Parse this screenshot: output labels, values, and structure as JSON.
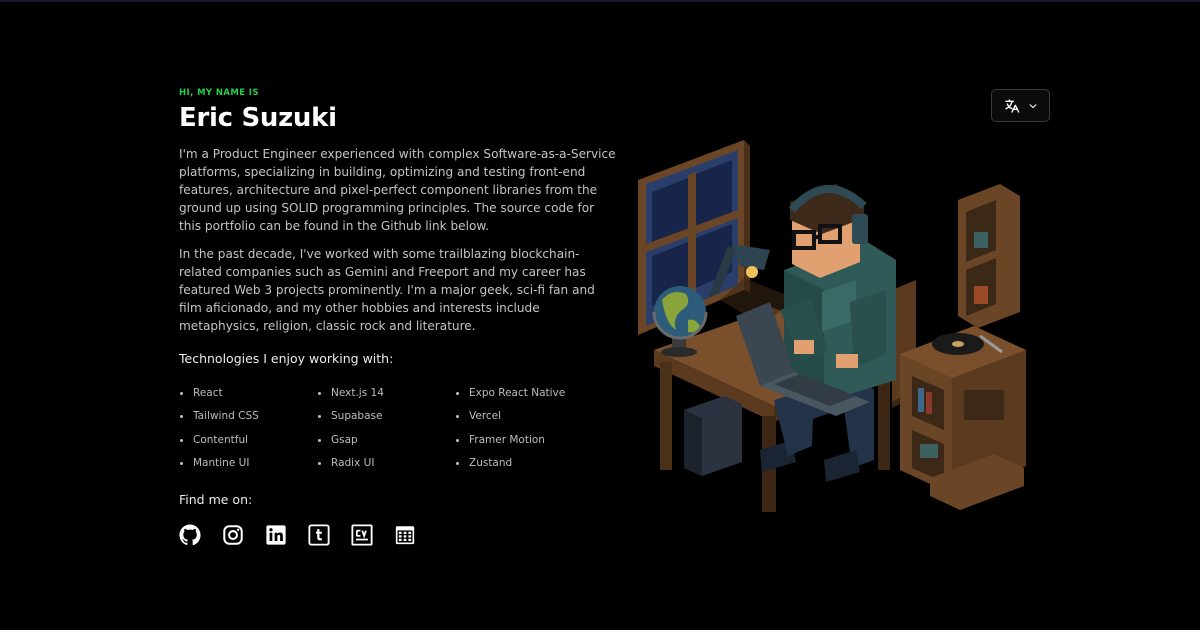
{
  "hero": {
    "eyebrow": "HI, MY NAME IS",
    "name": "Eric Suzuki",
    "paragraph1": "I'm a Product Engineer experienced with complex Software-as-a-Service platforms, specializing in building, optimizing and testing front-end features, architecture and pixel-perfect component libraries from the ground up using SOLID programming principles. The source code for this portfolio can be found in the Github link below.",
    "paragraph2": "In the past decade, I've worked with some trailblazing blockchain-related companies such as Gemini and Freeport and my career has featured Web 3 projects prominently. I'm a major geek, sci-fi fan and film aficionado, and my other hobbies and interests include metaphysics, religion, classic rock and literature."
  },
  "technologies": {
    "title": "Technologies I enjoy working with:",
    "items": [
      "React",
      "Next.js 14",
      "Expo React Native",
      "Tailwind CSS",
      "Supabase",
      "Vercel",
      "Contentful",
      "Gsap",
      "Framer Motion",
      "Mantine UI",
      "Radix UI",
      "Zustand"
    ]
  },
  "find": {
    "title": "Find me on:",
    "icons": [
      "github-icon",
      "instagram-icon",
      "linkedin-icon",
      "tumblr-icon",
      "cv-icon",
      "calendar-icon"
    ]
  },
  "language_selector": {
    "icon": "translate-icon",
    "caret": "chevron-down-icon"
  },
  "colors": {
    "accent": "#22d04a",
    "background": "#000000",
    "text": "#ffffff",
    "muted": "#c4c4c4"
  }
}
